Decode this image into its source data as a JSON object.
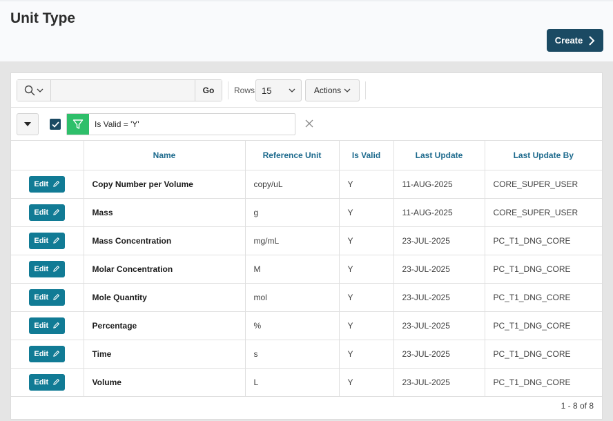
{
  "page": {
    "title": "Unit Type",
    "create_label": "Create"
  },
  "toolbar": {
    "search_placeholder": "",
    "search_value": "",
    "go_label": "Go",
    "rows_label": "Rows",
    "rows_value": "15",
    "actions_label": "Actions"
  },
  "filter": {
    "text": "Is Valid = 'Y'",
    "enabled": true
  },
  "table": {
    "columns": [
      "",
      "Name",
      "Reference Unit",
      "Is Valid",
      "Last Update",
      "Last Update By"
    ],
    "edit_label": "Edit",
    "rows": [
      {
        "name": "Copy Number per Volume",
        "ref_unit": "copy/uL",
        "is_valid": "Y",
        "last_update": "11-AUG-2025",
        "last_update_by": "CORE_SUPER_USER"
      },
      {
        "name": "Mass",
        "ref_unit": "g",
        "is_valid": "Y",
        "last_update": "11-AUG-2025",
        "last_update_by": "CORE_SUPER_USER"
      },
      {
        "name": "Mass Concentration",
        "ref_unit": "mg/mL",
        "is_valid": "Y",
        "last_update": "23-JUL-2025",
        "last_update_by": "PC_T1_DNG_CORE"
      },
      {
        "name": "Molar Concentration",
        "ref_unit": "M",
        "is_valid": "Y",
        "last_update": "23-JUL-2025",
        "last_update_by": "PC_T1_DNG_CORE"
      },
      {
        "name": "Mole Quantity",
        "ref_unit": "mol",
        "is_valid": "Y",
        "last_update": "23-JUL-2025",
        "last_update_by": "PC_T1_DNG_CORE"
      },
      {
        "name": "Percentage",
        "ref_unit": "%",
        "is_valid": "Y",
        "last_update": "23-JUL-2025",
        "last_update_by": "PC_T1_DNG_CORE"
      },
      {
        "name": "Time",
        "ref_unit": "s",
        "is_valid": "Y",
        "last_update": "23-JUL-2025",
        "last_update_by": "PC_T1_DNG_CORE"
      },
      {
        "name": "Volume",
        "ref_unit": "L",
        "is_valid": "Y",
        "last_update": "23-JUL-2025",
        "last_update_by": "PC_T1_DNG_CORE"
      }
    ]
  },
  "pagination": {
    "text": "1 - 8 of 8"
  },
  "colors": {
    "primary": "#1b4a63",
    "edit": "#117b95",
    "filter_green": "#2ebf6a",
    "header_link": "#1d6a8d"
  }
}
